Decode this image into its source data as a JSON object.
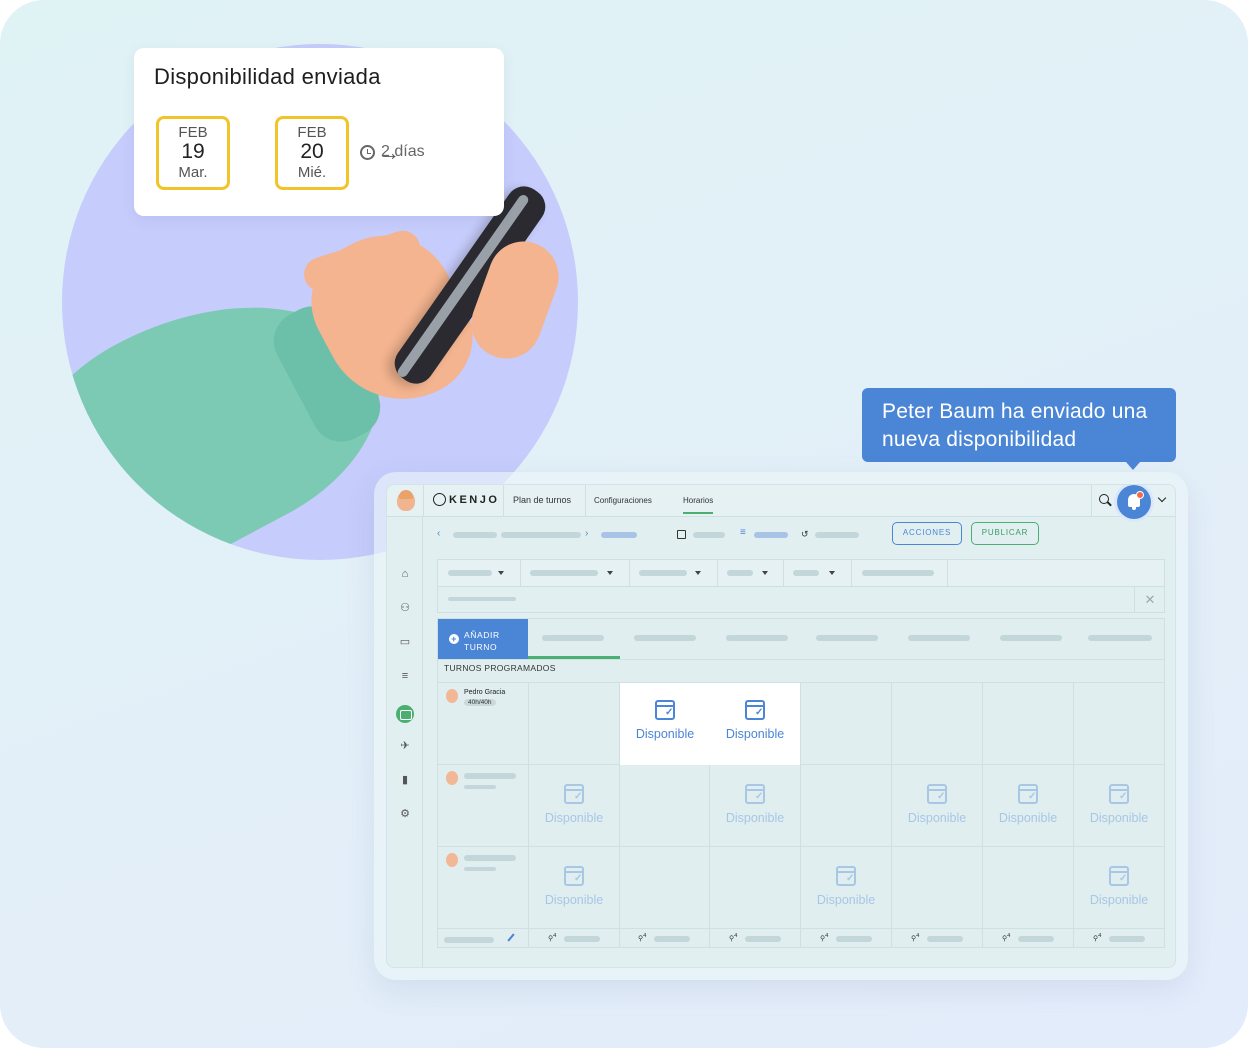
{
  "notification_card": {
    "title": "Disponibilidad enviada",
    "start": {
      "month": "FEB",
      "day": "19",
      "weekday": "Mar."
    },
    "end": {
      "month": "FEB",
      "day": "20",
      "weekday": "Mié."
    },
    "duration": "2 días"
  },
  "tooltip": {
    "text": "Peter Baum ha enviado una nueva disponibilidad"
  },
  "app": {
    "logo": "KENJO",
    "nav": [
      "Plan de turnos",
      "Configuraciones",
      "Horarios"
    ],
    "buttons": {
      "actions": "ACCIONES",
      "publish": "PUBLICAR"
    },
    "add_shift": "AÑADIR TURNO",
    "section_label": "TURNOS PROGRAMADOS",
    "employee": {
      "name": "Pedro Gracia",
      "hours": "40h/40h"
    },
    "available_label": "Disponible",
    "footer_count": "4",
    "colors": {
      "accent_blue": "#4b86d6",
      "accent_green": "#4caf72",
      "highlight": "#f1c42a"
    }
  }
}
